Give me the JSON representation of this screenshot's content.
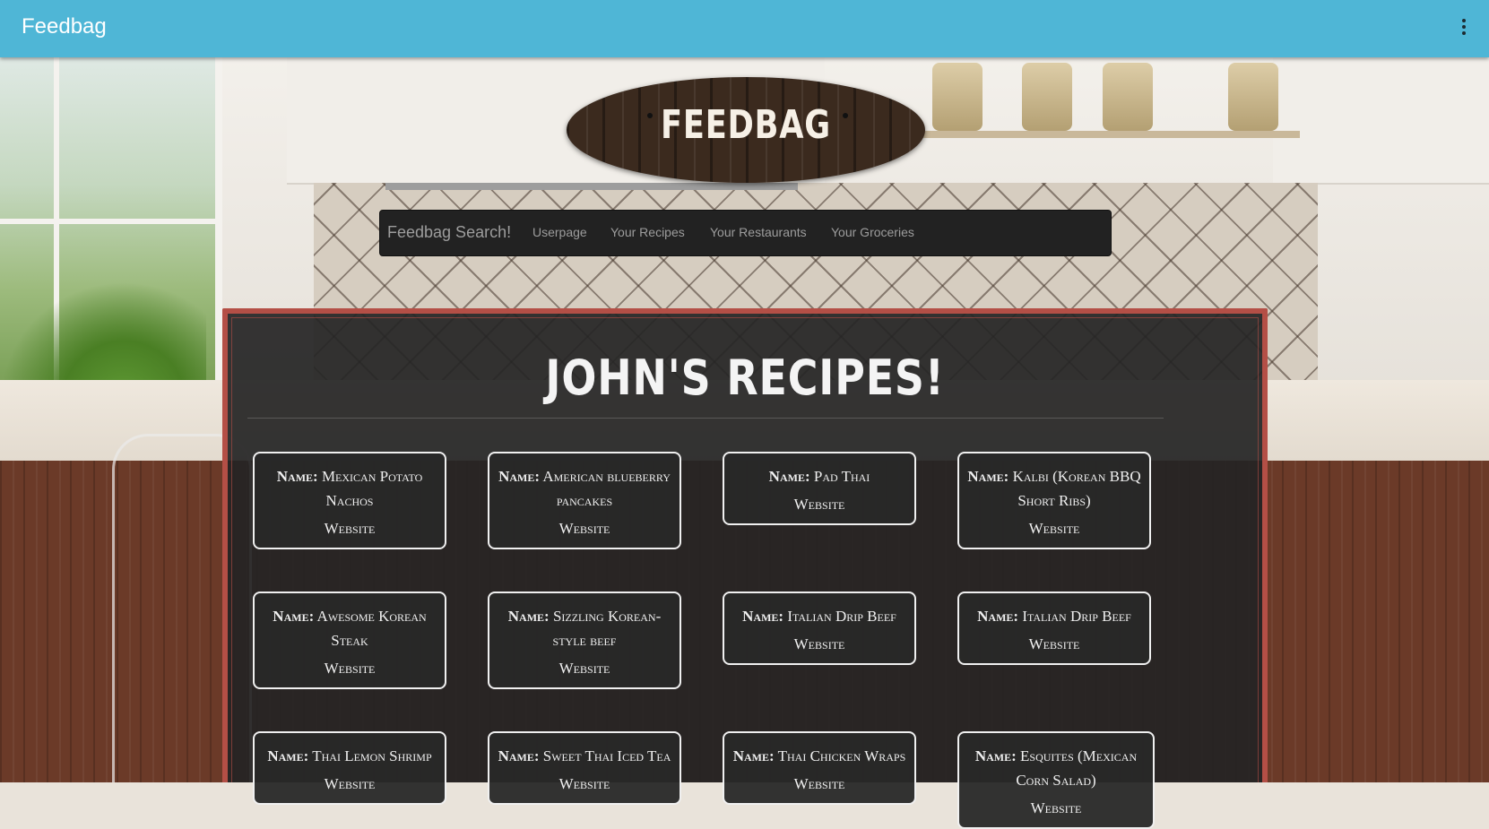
{
  "appbar": {
    "title": "Feedbag"
  },
  "logo": {
    "text": "FEEDBAG"
  },
  "navbar": {
    "brand": "Feedbag Search!",
    "links": [
      "Userpage",
      "Your Recipes",
      "Your Restaurants",
      "Your Groceries"
    ]
  },
  "panel": {
    "title": "JOHN'S RECIPES!",
    "name_label": "Name:",
    "website_label": "Website",
    "recipes": [
      "Mexican Potato Nachos",
      "American blueberry pancakes",
      "Pad Thai",
      "Kalbi (Korean BBQ Short Ribs)",
      "Awesome Korean Steak",
      "Sizzling Korean-style beef",
      "Italian Drip Beef",
      "Italian Drip Beef",
      "Thai Lemon Shrimp",
      "Sweet Thai Iced Tea",
      "Thai Chicken Wraps",
      "Esquites (Mexican Corn Salad)"
    ]
  },
  "colors": {
    "appbar": "#4fb6d6",
    "navbar": "#222222",
    "panel_border": "#b44f46",
    "panel_bg": "#242424"
  }
}
